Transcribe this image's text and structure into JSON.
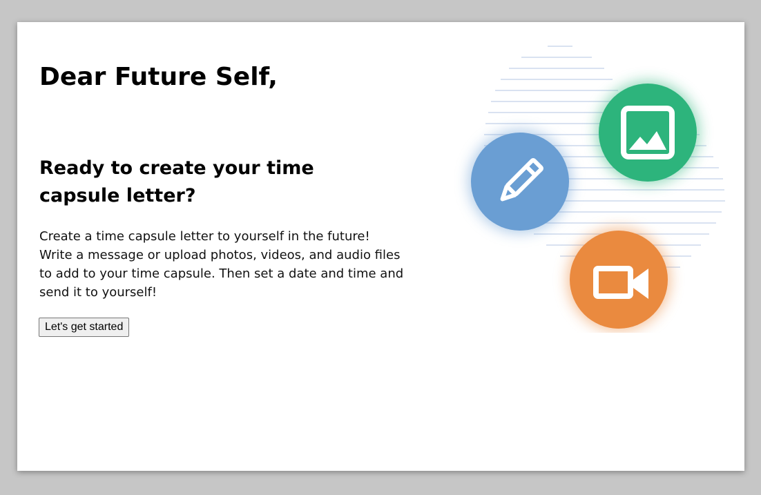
{
  "header": {
    "title": "Dear Future Self,"
  },
  "intro": {
    "heading": "Ready to create your time capsule letter?",
    "body": "Create a time capsule letter to yourself in the future! Write a message or upload photos, videos, and audio files to add to your time capsule. Then set a date and time and send it to yourself!",
    "start_label": "Let's get started"
  },
  "illustration": {
    "icons": [
      {
        "name": "pencil-icon",
        "color": "#6a9ed3"
      },
      {
        "name": "image-icon",
        "color": "#2db47c"
      },
      {
        "name": "video-camera-icon",
        "color": "#ea8a3f"
      }
    ],
    "stripe_color": "#d9e2f1"
  }
}
